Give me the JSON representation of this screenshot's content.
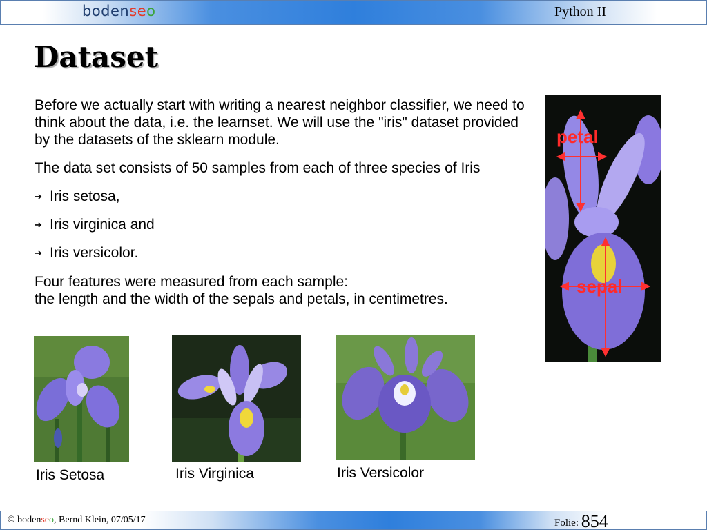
{
  "header": {
    "logo": {
      "part1": "boden",
      "part2": "se",
      "part3": "o"
    },
    "course": "Python II"
  },
  "slide": {
    "title": "Dataset",
    "intro": "Before we actually start with writing a nearest neighbor classifier, we need to think about the data, i.e. the learnset. We will use the \"iris\" dataset provided by the datasets of the sklearn module.",
    "consists": "The data set consists of 50 samples from each of three species of Iris",
    "species": [
      "Iris setosa,",
      "Iris virginica and",
      "Iris versicolor."
    ],
    "features_line1": "Four features were measured from each sample:",
    "features_line2": "the length and the width of the sepals and petals, in centimetres.",
    "diagram_labels": {
      "petal": "petal",
      "sepal": "sepal"
    },
    "captions": [
      "Iris Setosa",
      "Iris Virginica",
      "Iris Versicolor"
    ]
  },
  "footer": {
    "copyright": "©",
    "brand_a": "boden",
    "brand_b": "se",
    "brand_c": "o",
    "author_date": ", Bernd Klein, 07/05/17",
    "folie_label": "Folie:",
    "slide_number": "854"
  },
  "colors": {
    "arrow_red": "#ff3030",
    "petal_violet": "#8a78e0",
    "bar_blue": "#2f7fdc"
  }
}
